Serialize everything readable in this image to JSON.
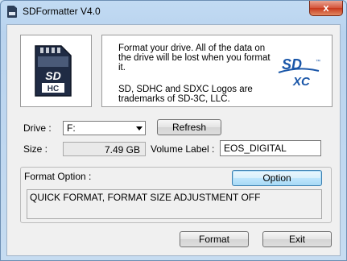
{
  "window": {
    "title": "SDFormatter V4.0",
    "close_label": "x"
  },
  "info": {
    "line1": "Format your drive. All of the data on the drive will be lost when you format it.",
    "line2": "SD, SDHC and SDXC Logos are trademarks of SD-3C, LLC.",
    "card_logo_text": "SD HC",
    "brand_logo_text": "SDXC"
  },
  "drive": {
    "label": "Drive :",
    "value": "F:",
    "refresh_label": "Refresh"
  },
  "size": {
    "label": "Size :",
    "value": "7.49 GB"
  },
  "volume": {
    "label": "Volume Label :",
    "value": "EOS_DIGITAL"
  },
  "format_option": {
    "label": "Format Option :",
    "option_button": "Option",
    "summary": "QUICK FORMAT, FORMAT SIZE ADJUSTMENT OFF"
  },
  "actions": {
    "format_label": "Format",
    "exit_label": "Exit"
  },
  "colors": {
    "accent": "#1a56a8",
    "card": "#1f2b44"
  }
}
